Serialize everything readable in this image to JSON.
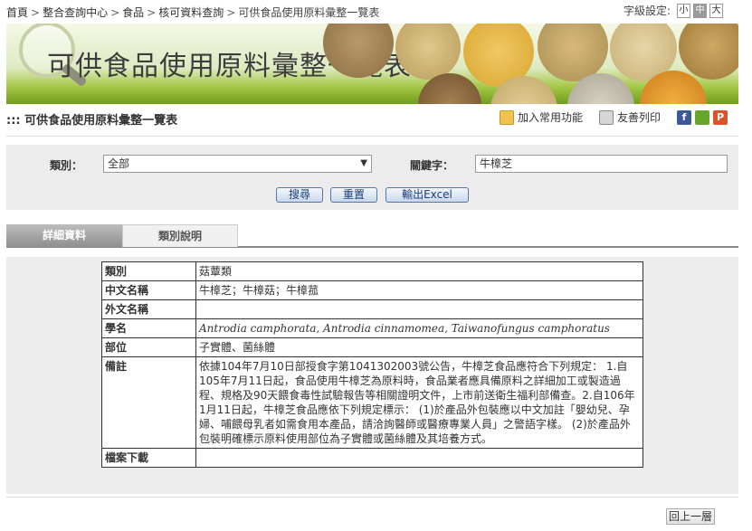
{
  "breadcrumb": {
    "home": "首頁",
    "center": "整合查詢中心",
    "food": "食品",
    "data": "核可資料查詢",
    "current": "可供食品使用原料彙整一覽表",
    "sep": ">"
  },
  "font_size": {
    "label": "字級設定:",
    "small": "小",
    "medium": "中",
    "large": "大"
  },
  "banner": {
    "title": "可供食品使用原料彙整一覽表"
  },
  "page": {
    "prefix": ":::",
    "title": "可供食品使用原料彙整一覽表"
  },
  "tools": {
    "favorite": "加入常用功能",
    "print": "友善列印",
    "facebook_icon": "f",
    "plurk_icon": "P"
  },
  "search": {
    "category_label": "類別：",
    "category_value": "全部",
    "keyword_label": "關鍵字：",
    "keyword_value": "牛樟芝",
    "search_button": "搜尋",
    "reset_button": "重置",
    "export_button": "輸出Excel"
  },
  "tabs": {
    "detail": "詳細資料",
    "category_note": "類別說明"
  },
  "detail": {
    "rows": [
      {
        "key": "類別",
        "value": "菇蕈類"
      },
      {
        "key": "中文名稱",
        "value": "牛樟芝；牛樟菇；牛樟菰"
      },
      {
        "key": "外文名稱",
        "value": ""
      },
      {
        "key": "學名",
        "value": "Antrodia camphorata, Antrodia cinnamomea, Taiwanofungus camphoratus"
      },
      {
        "key": "部位",
        "value": "子實體、菌絲體"
      },
      {
        "key": "備註",
        "value": "依據104年7月10日部授食字第1041302003號公告，牛樟芝食品應符合下列規定： 1.自105年7月11日起，食品使用牛樟芝為原料時，食品業者應具備原料之詳細加工或製造過程、規格及90天餵食毒性試驗報告等相關證明文件，上市前送衛生福利部備查。2.自106年1月11日起，牛樟芝食品應依下列規定標示： (1)於產品外包裝應以中文加註「嬰幼兒、孕婦、哺餵母乳者如需食用本產品，請洽詢醫師或醫療專業人員」之警語字樣。 (2)於產品外包裝明確標示原料使用部位為子實體或菌絲體及其培養方式。"
      },
      {
        "key": "檔案下載",
        "value": ""
      }
    ]
  },
  "footer": {
    "back_button": "回上一層"
  }
}
